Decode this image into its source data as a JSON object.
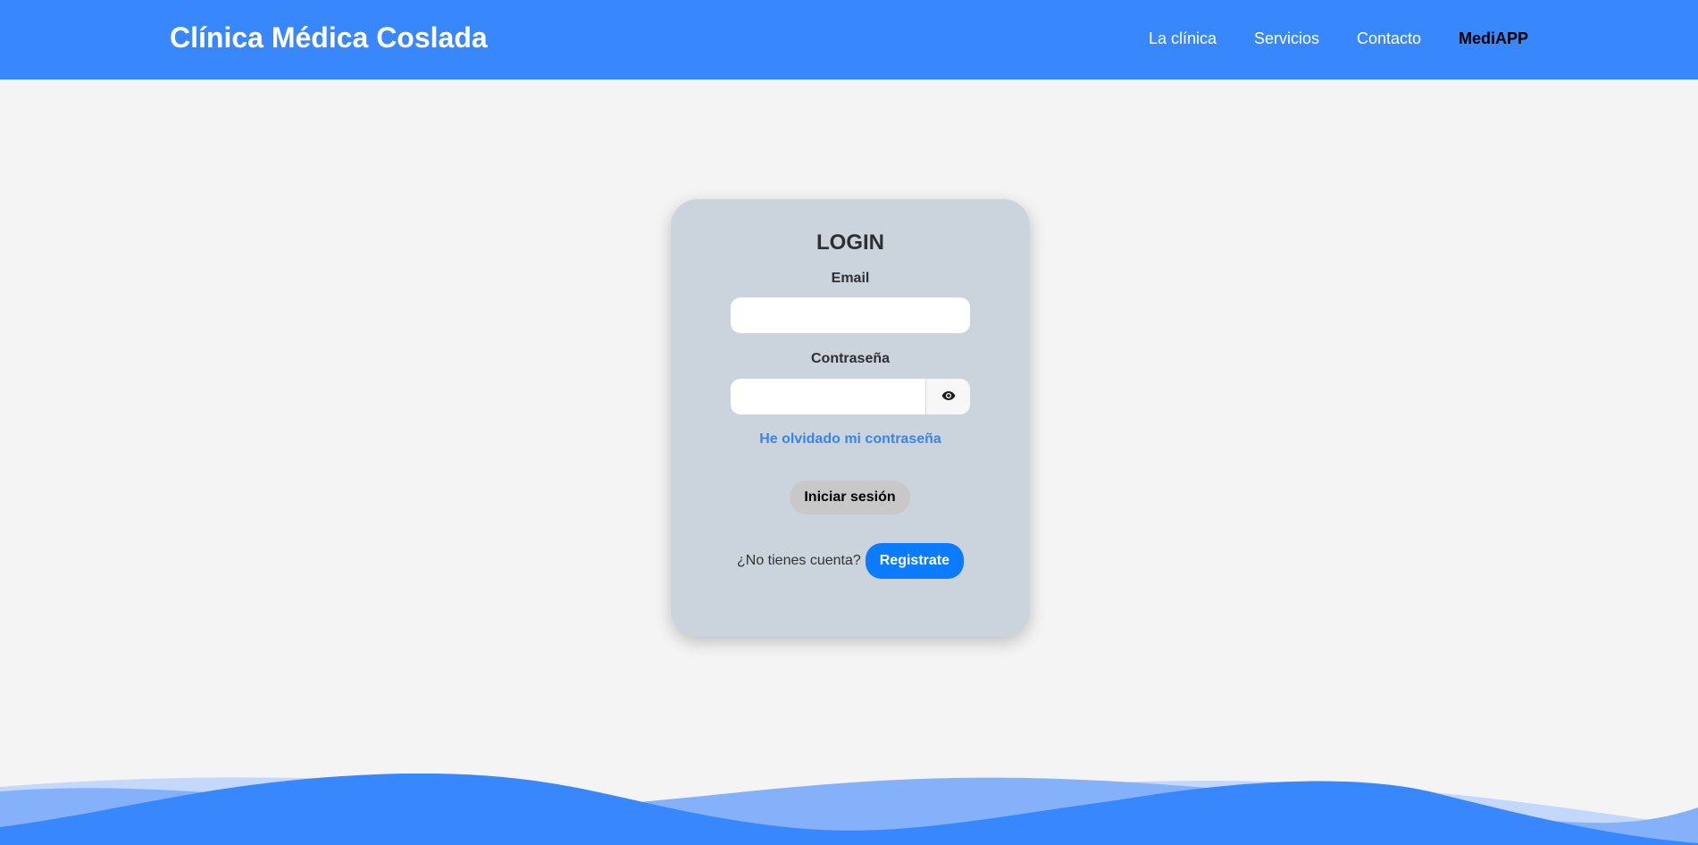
{
  "header": {
    "brand": "Clínica Médica Coslada",
    "nav": [
      {
        "label": "La clínica",
        "active": false
      },
      {
        "label": "Servicios",
        "active": false
      },
      {
        "label": "Contacto",
        "active": false
      },
      {
        "label": "MediAPP",
        "active": true
      }
    ]
  },
  "login": {
    "title": "LOGIN",
    "email_label": "Email",
    "email_value": "",
    "password_label": "Contraseña",
    "password_value": "",
    "toggle_icon": "eye-icon",
    "forgot_label": "He olvidado mi contraseña",
    "submit_label": "Iniciar sesión",
    "register_question": "¿No tienes cuenta?",
    "register_label": "Registrate"
  },
  "colors": {
    "primary": "#3887fd",
    "page_bg": "#f4f4f4",
    "card_bg": "#cbd3dd",
    "link": "#3a85ea",
    "register_button": "#0b7cff",
    "submit_button": "#c8c8c8"
  }
}
